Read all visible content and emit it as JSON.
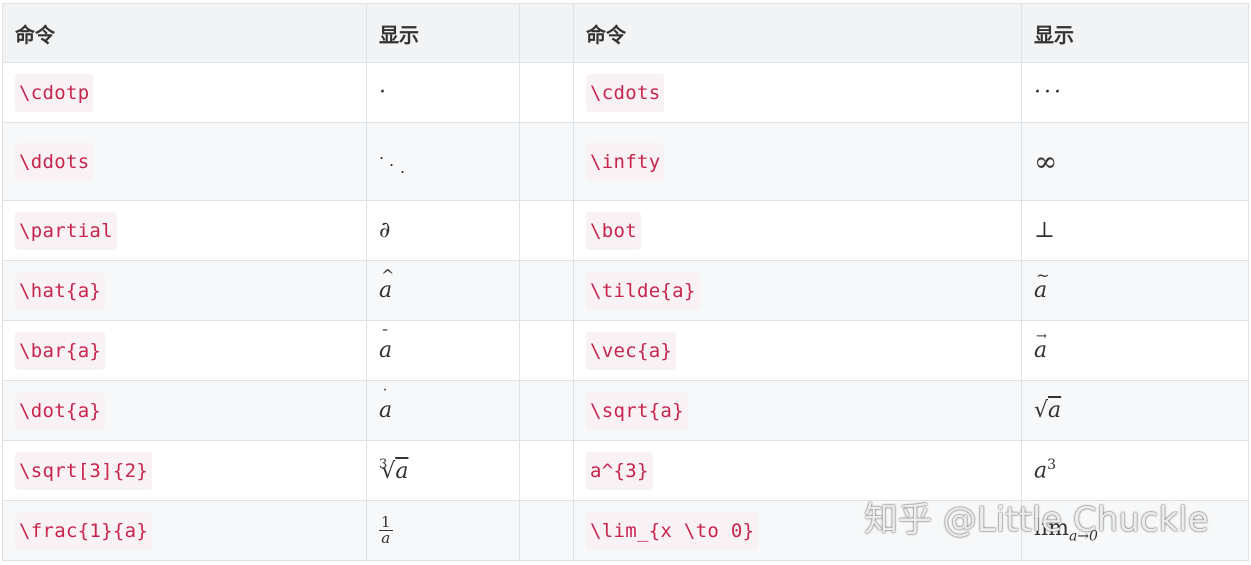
{
  "table": {
    "headers": [
      "命令",
      "显示",
      "",
      "命令",
      "显示"
    ],
    "rows": [
      {
        "cmd1": "\\cdotp",
        "disp1": "·",
        "cmd2": "\\cdots",
        "disp2": "···"
      },
      {
        "cmd1": "\\ddots",
        "disp1": "⋱",
        "cmd2": "\\infty",
        "disp2": "∞"
      },
      {
        "cmd1": "\\partial",
        "disp1": "∂",
        "cmd2": "\\bot",
        "disp2": "⊥"
      },
      {
        "cmd1": "\\hat{a}",
        "disp1": "â",
        "cmd2": "\\tilde{a}",
        "disp2": "ã"
      },
      {
        "cmd1": "\\bar{a}",
        "disp1": "ā",
        "cmd2": "\\vec{a}",
        "disp2": "a⃗"
      },
      {
        "cmd1": "\\dot{a}",
        "disp1": "ȧ",
        "cmd2": "\\sqrt{a}",
        "disp2": "√a"
      },
      {
        "cmd1": "\\sqrt[3]{2}",
        "disp1": "∛a",
        "cmd2": "a^{3}",
        "disp2": "a³"
      },
      {
        "cmd1": "\\frac{1}{a}",
        "disp1": "1/a",
        "cmd2": "\\lim_{x \\to 0}",
        "disp2": "lim a→0"
      }
    ]
  },
  "render": {
    "frac_num": "1",
    "frac_den": "a",
    "root_index": "3",
    "radicand": "a",
    "sup_base": "a",
    "sup_exp": "3",
    "lim_word": "lim",
    "lim_sub": "a→0",
    "hat": "^",
    "tilde": "~",
    "bar": "¯",
    "vec": "→",
    "dot": "˙",
    "letter": "a",
    "ddot": "."
  },
  "watermark": "知乎 @Little Chuckle"
}
